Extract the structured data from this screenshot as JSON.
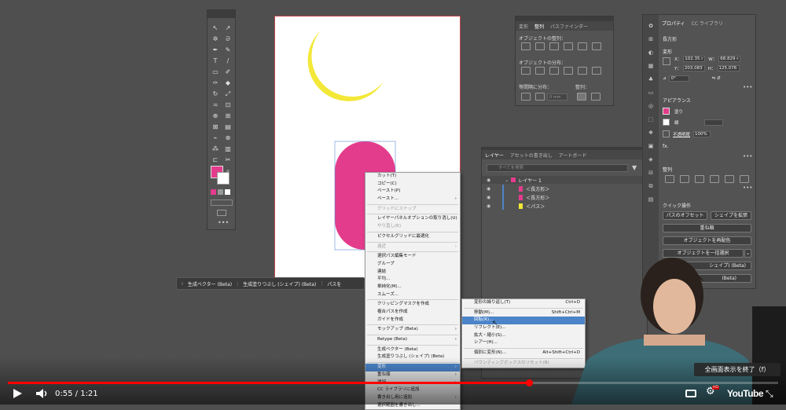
{
  "toolbar": {
    "color_fill": "#e43c8c"
  },
  "properties": {
    "tabs": [
      "プロパティ",
      "CC ライブラリ"
    ],
    "object_type": "長方形",
    "transform_label": "変形",
    "x_label": "X：",
    "x_value": "102.35 r",
    "w_label": "W：",
    "w_value": "68.829 r",
    "y_label": "Y：",
    "y_value": "203.083",
    "h_label": "H：",
    "h_value": "125.076",
    "angle_value": "0°",
    "appearance_label": "アピアランス",
    "fill_label": "塗り",
    "stroke_label": "線",
    "opacity_label": "不透明度",
    "opacity_value": "100%",
    "fx_label": "fx.",
    "align_label": "整列",
    "quick_actions_label": "クイック操作",
    "buttons": {
      "path_offset": "パスのオフセット",
      "shape_expand": "シェイプを拡張",
      "front": "重ね順",
      "recolor": "オブジェクトを再配色",
      "select_same": "オブジェクトを一括選択",
      "shape_beta": "シェイプ) (Beta)",
      "beta": "(Beta)"
    }
  },
  "align_panel": {
    "tabs": [
      "変形",
      "整列",
      "パスファインダー"
    ],
    "align_objects_label": "オブジェクトの整列：",
    "distribute_objects_label": "オブジェクトの分布：",
    "distribute_spacing_label": "等間隔に分布：",
    "align_to_label": "整列：",
    "spacing_value": "0 mm"
  },
  "layers_panel": {
    "tabs": [
      "レイヤー",
      "アセットの書き出し",
      "アートボード"
    ],
    "search_placeholder": "すべてを検索",
    "layer_name": "レイヤー 1",
    "items": [
      "＜長方形＞",
      "＜長方形＞",
      "＜パス＞"
    ]
  },
  "context_menu": {
    "items": [
      {
        "label": "カット(T)",
        "dis": false
      },
      {
        "label": "コピー(C)",
        "dis": false
      },
      {
        "label": "ペースト(P)",
        "dis": false
      },
      {
        "label": "ペースト...",
        "dis": false,
        "sub": true
      },
      {
        "sep": true
      },
      {
        "label": "グリッドにスナップ",
        "dis": true
      },
      {
        "sep": true
      },
      {
        "label": "レイヤーパネルオプションの取り消し(U)",
        "dis": false
      },
      {
        "label": "やり直し(R)",
        "dis": true
      },
      {
        "sep": true
      },
      {
        "label": "ピクセルグリッドに最適化",
        "dis": false
      },
      {
        "sep": true
      },
      {
        "label": "遠近",
        "dis": true,
        "sub": true
      },
      {
        "sep": true
      },
      {
        "label": "選択パス編集モード",
        "dis": false
      },
      {
        "label": "グループ",
        "dis": false
      },
      {
        "label": "連結",
        "dis": false
      },
      {
        "label": "平均...",
        "dis": false
      },
      {
        "label": "単純化(M)...",
        "dis": false
      },
      {
        "label": "スムーズ...",
        "dis": false
      },
      {
        "sep": true
      },
      {
        "label": "クリッピングマスクを作成",
        "dis": false
      },
      {
        "label": "複合パスを作成",
        "dis": false
      },
      {
        "label": "ガイドを作成",
        "dis": false
      },
      {
        "sep": true
      },
      {
        "label": "モックアップ (Beta)",
        "dis": false,
        "sub": true
      },
      {
        "sep": true
      },
      {
        "label": "Retype (Beta)",
        "dis": false,
        "sub": true
      },
      {
        "sep": true
      },
      {
        "label": "生成ベクター (Beta)",
        "dis": false
      },
      {
        "label": "生成塗りつぶし (シェイプ) (Beta)",
        "dis": false
      },
      {
        "sep": true
      },
      {
        "label": "変形",
        "dis": false,
        "sub": true,
        "sel": true
      },
      {
        "label": "重ね順",
        "dis": false,
        "sub": true
      },
      {
        "label": "選択",
        "dis": false,
        "sub": true
      },
      {
        "label": "CC ライブラリに追加",
        "dis": false
      },
      {
        "label": "書き出し用に追加",
        "dis": false,
        "sub": true
      },
      {
        "label": "選択範囲を書き出し...",
        "dis": false
      }
    ]
  },
  "submenu": {
    "items": [
      {
        "label": "変形の繰り返し(T)",
        "shortcut": "Ctrl+D"
      },
      {
        "sep": true
      },
      {
        "label": "移動(M)...",
        "shortcut": "Shift+Ctrl+M"
      },
      {
        "label": "回転(R)...",
        "shortcut": "",
        "sel": true
      },
      {
        "label": "リフレクト(E)...",
        "shortcut": ""
      },
      {
        "label": "拡大・縮小(S)...",
        "shortcut": ""
      },
      {
        "label": "シアー(H)...",
        "shortcut": ""
      },
      {
        "sep": true
      },
      {
        "label": "個別に変形(N)...",
        "shortcut": "Alt+Shift+Ctrl+D"
      },
      {
        "sep": true
      },
      {
        "label": "バウンディングボックスのリセット(B)",
        "shortcut": "",
        "dis": true
      }
    ]
  },
  "taskbar": {
    "gen_vector": "生成ベクター (Beta)",
    "gen_fill": "生成塗りつぶし (シェイプ) (Beta)",
    "path": "パスを"
  },
  "player": {
    "current": "0:55",
    "duration": "1:21",
    "separator": " / ",
    "progress": 0.677,
    "exit_fullscreen": "全画面表示を終了（f）",
    "logo": "YouTube",
    "hd_badge": "HD"
  }
}
